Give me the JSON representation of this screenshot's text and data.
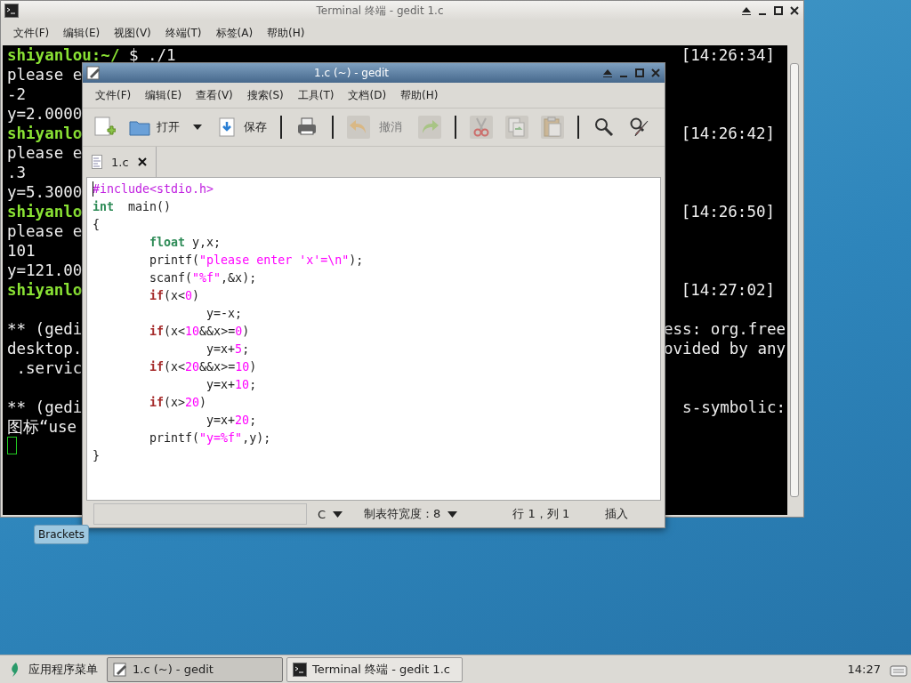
{
  "terminal": {
    "title": "Terminal 终端 - gedit 1.c",
    "menu": [
      "文件(F)",
      "编辑(E)",
      "视图(V)",
      "终端(T)",
      "标签(A)",
      "帮助(H)"
    ],
    "lines": [
      {
        "prompt": "shiyanlou:~/",
        "text": " $ ./1",
        "time": "[14:26:34]",
        "spaced": false
      },
      {
        "text": "please e",
        "spaced": false
      },
      {
        "text": "-2",
        "spaced": false
      },
      {
        "text": "y=2.0000",
        "spaced": false
      },
      {
        "prompt": "shiyanlo",
        "time": "[14:26:42]",
        "spaced": false
      },
      {
        "text": "please e",
        "spaced": false
      },
      {
        "text": ".3",
        "spaced": false
      },
      {
        "text": "y=5.3000",
        "spaced": false
      },
      {
        "prompt": "shiyanlo",
        "time": "[14:26:50]",
        "spaced": false
      },
      {
        "text": "please e",
        "spaced": false
      },
      {
        "text": "101",
        "spaced": false
      },
      {
        "text": "y=121.00",
        "spaced": false
      },
      {
        "prompt": "shiyanlo",
        "time": "[14:27:02]",
        "spaced": false
      },
      {
        "text": "** (gedi",
        "tail": "ess: org.free",
        "spaced": true
      },
      {
        "text": "desktop.",
        "tail": "ovided by any",
        "spaced": false
      },
      {
        "text": " .servic",
        "spaced": false
      },
      {
        "text": "** (gedi",
        "tail": "s-symbolic:",
        "spaced": true
      },
      {
        "text": "图标“use",
        "spaced": false
      }
    ]
  },
  "gedit": {
    "title": "1.c (~) - gedit",
    "menu": [
      "文件(F)",
      "编辑(E)",
      "查看(V)",
      "搜索(S)",
      "工具(T)",
      "文档(D)",
      "帮助(H)"
    ],
    "toolbar": [
      {
        "kind": "new",
        "disabled": false
      },
      {
        "kind": "open",
        "label": "打开",
        "disabled": false
      },
      {
        "kind": "arrow",
        "disabled": false
      },
      {
        "kind": "save",
        "label": "保存",
        "disabled": false
      },
      {
        "kind": "separator"
      },
      {
        "kind": "print",
        "disabled": false
      },
      {
        "kind": "separator"
      },
      {
        "kind": "undo",
        "label": "撤消",
        "disabled": true
      },
      {
        "kind": "redo",
        "disabled": true
      },
      {
        "kind": "separator"
      },
      {
        "kind": "cut",
        "disabled": true
      },
      {
        "kind": "copy",
        "disabled": true
      },
      {
        "kind": "paste",
        "disabled": true
      },
      {
        "kind": "separator"
      },
      {
        "kind": "find",
        "disabled": false
      },
      {
        "kind": "replace",
        "disabled": false
      }
    ],
    "tabs": [
      {
        "label": "1.c",
        "selected": true
      }
    ],
    "code": [
      [
        {
          "kind": "preproc",
          "t": "#include<stdio.h>"
        }
      ],
      [
        {
          "kind": "type",
          "t": "int"
        },
        {
          "kind": "plain",
          "t": "  main()"
        }
      ],
      [
        {
          "kind": "plain",
          "t": "{"
        }
      ],
      [
        {
          "kind": "type",
          "t": "        float"
        },
        {
          "kind": "plain",
          "t": " y,x;"
        }
      ],
      [
        {
          "kind": "plain",
          "t": "        printf("
        },
        {
          "kind": "string",
          "t": "\"please enter 'x'=\\n\""
        },
        {
          "kind": "plain",
          "t": ");"
        }
      ],
      [
        {
          "kind": "plain",
          "t": "        scanf("
        },
        {
          "kind": "string",
          "t": "\"%f\""
        },
        {
          "kind": "plain",
          "t": ",&x);"
        }
      ],
      [
        {
          "kind": "keyword",
          "t": "        if"
        },
        {
          "kind": "plain",
          "t": "(x<"
        },
        {
          "kind": "number",
          "t": "0"
        },
        {
          "kind": "plain",
          "t": ")"
        }
      ],
      [
        {
          "kind": "plain",
          "t": "                y=-x;"
        }
      ],
      [
        {
          "kind": "keyword",
          "t": "        if"
        },
        {
          "kind": "plain",
          "t": "(x<"
        },
        {
          "kind": "number",
          "t": "10"
        },
        {
          "kind": "plain",
          "t": "&&x>="
        },
        {
          "kind": "number",
          "t": "0"
        },
        {
          "kind": "plain",
          "t": ")"
        }
      ],
      [
        {
          "kind": "plain",
          "t": "                y=x+"
        },
        {
          "kind": "number",
          "t": "5"
        },
        {
          "kind": "plain",
          "t": ";"
        }
      ],
      [
        {
          "kind": "keyword",
          "t": "        if"
        },
        {
          "kind": "plain",
          "t": "(x<"
        },
        {
          "kind": "number",
          "t": "20"
        },
        {
          "kind": "plain",
          "t": "&&x>="
        },
        {
          "kind": "number",
          "t": "10"
        },
        {
          "kind": "plain",
          "t": ")"
        }
      ],
      [
        {
          "kind": "plain",
          "t": "                y=x+"
        },
        {
          "kind": "number",
          "t": "10"
        },
        {
          "kind": "plain",
          "t": ";"
        }
      ],
      [
        {
          "kind": "keyword",
          "t": "        if"
        },
        {
          "kind": "plain",
          "t": "(x>"
        },
        {
          "kind": "number",
          "t": "20"
        },
        {
          "kind": "plain",
          "t": ")"
        }
      ],
      [
        {
          "kind": "plain",
          "t": "                y=x+"
        },
        {
          "kind": "number",
          "t": "20"
        },
        {
          "kind": "plain",
          "t": ";"
        }
      ],
      [
        {
          "kind": "plain",
          "t": "        printf("
        },
        {
          "kind": "string",
          "t": "\"y=%f\""
        },
        {
          "kind": "plain",
          "t": ",y);"
        }
      ],
      [
        {
          "kind": "plain",
          "t": "}"
        }
      ]
    ],
    "status": {
      "language": "C",
      "tab_width": "制表符宽度：8",
      "position": "行 1，列 1",
      "mode": "插入"
    }
  },
  "tooltip": "Brackets",
  "taskbar": {
    "app_menu": "应用程序菜单",
    "tasks": [
      {
        "title": "1.c (~) - gedit",
        "selected": true,
        "kind": "gedit"
      },
      {
        "title": "Terminal 终端 - gedit 1.c",
        "selected": false,
        "kind": "terminal"
      }
    ],
    "clock": "14:27"
  }
}
